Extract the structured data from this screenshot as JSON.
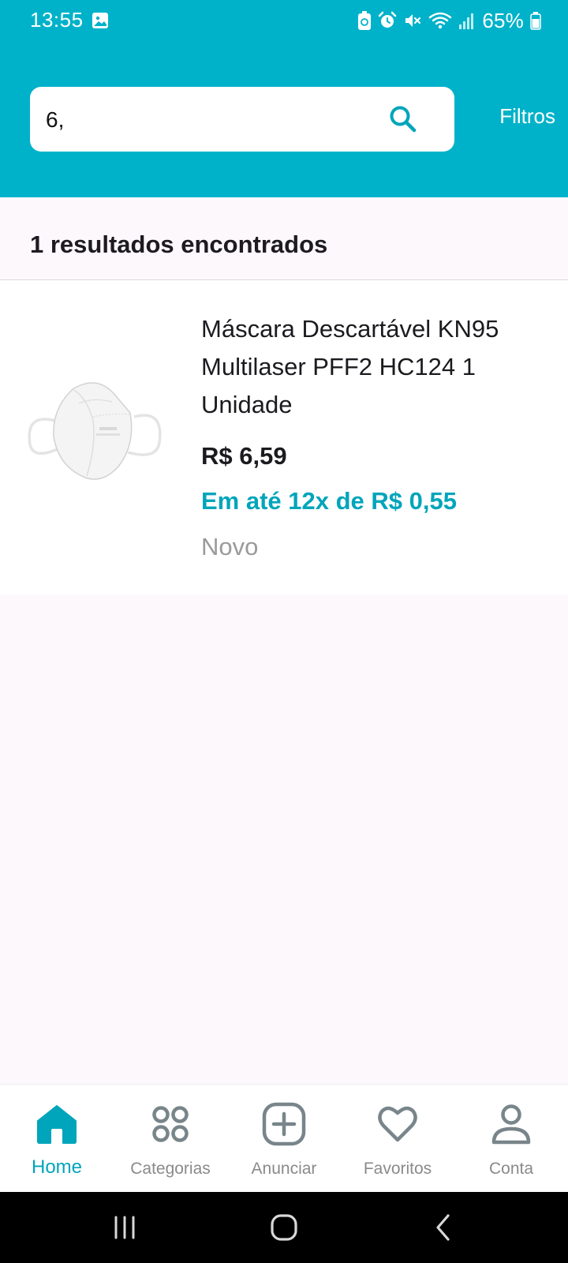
{
  "status_bar": {
    "time": "13:55",
    "battery": "65%"
  },
  "search": {
    "value": "6,",
    "icon": "search-icon"
  },
  "header": {
    "filters_label": "Filtros"
  },
  "results": {
    "count_text": "1 resultados encontrados",
    "items": [
      {
        "title": "Máscara Descartável KN95 Multilaser PFF2 HC124 1 Unidade",
        "price": "R$ 6,59",
        "installments": "Em até 12x de R$ 0,55",
        "condition": "Novo"
      }
    ]
  },
  "bottom_nav": {
    "items": [
      {
        "label": "Home",
        "icon": "home-icon",
        "active": true
      },
      {
        "label": "Categorias",
        "icon": "categories-icon",
        "active": false
      },
      {
        "label": "Anunciar",
        "icon": "add-icon",
        "active": false
      },
      {
        "label": "Favoritos",
        "icon": "heart-icon",
        "active": false
      },
      {
        "label": "Conta",
        "icon": "person-icon",
        "active": false
      }
    ]
  },
  "colors": {
    "header": "#00b2c9",
    "accent": "#00a5bb",
    "background": "#fcf8fc",
    "nav_icon": "#78858a"
  }
}
